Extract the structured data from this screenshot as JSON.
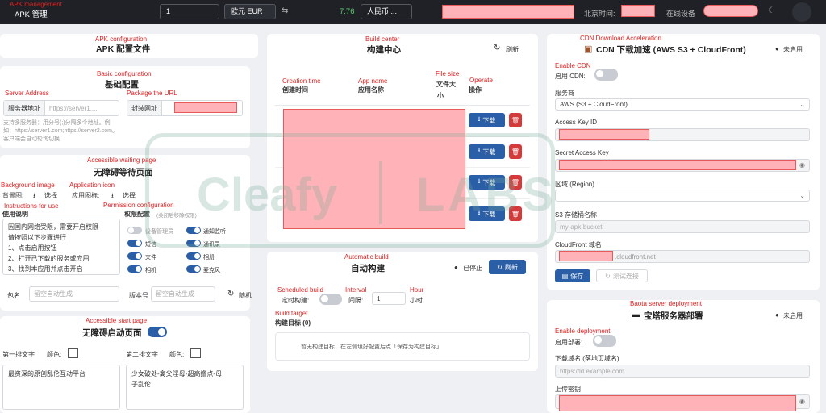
{
  "annotations": {
    "apk_management": "APK management",
    "apk_configuration": "APK configuration",
    "basic_configuration": "Basic configuration",
    "server_address": "Server Address",
    "package_url": "Package the URL",
    "accessible_waiting_page": "Accessible waiting page",
    "background_image": "Background image",
    "application_icon": "Application icon",
    "instructions_for_use": "Instructions for use",
    "permission_configuration": "Permission configuration",
    "accessible_start_page": "Accessible start page",
    "build_center": "Build center",
    "creation_time": "Creation time",
    "app_name": "App name",
    "file_size": "File size",
    "operate": "Operate",
    "automatic_build": "Automatic build",
    "scheduled_build": "Scheduled build",
    "interval": "Interval",
    "hour": "Hour",
    "build_target": "Build target",
    "cdn_download_acceleration": "CDN Download Acceleration",
    "enable_cdn": "Enable CDN",
    "baota_deployment": "Baota server deployment",
    "enable_deployment": "Enable deployment"
  },
  "topbar": {
    "title": "APK 管理",
    "amount": "1",
    "from_currency": "欧元 EUR",
    "swap_icon": "⇆",
    "rate": "7.76",
    "to_currency": "人民币 ...",
    "beijing_time_label": "北京时间:",
    "online_label": "在线设备",
    "theme_icon": "☾"
  },
  "apk_config": {
    "title": "APK 配置文件",
    "basic_title": "基础配置",
    "server_label": "服务器地址",
    "server_placeholder": "https://server1....",
    "package_url_label": "封装网址",
    "server_help_1": "支持多服务器：用分号(;)分隔多个地址。例",
    "server_help_2": "如：https://server1.com;https://server2.com。",
    "server_help_3": "客户端会自动轮询切换",
    "waiting_title": "无障碍等待页面",
    "bg_label": "背景图:",
    "choose_1": "选择",
    "icon_label": "应用图标:",
    "choose_2": "选择",
    "instructions_label": "使用说明",
    "permission_label": "权限配置",
    "permission_hint": "(关闭后移除权限)",
    "instructions_lines": [
      "因国内网络受限，需要开启权限",
      "请按照以下步骤进行",
      "1、点击启用按钮",
      "2、打开已下载的服务或应用",
      "3、找到本应用并点击开启"
    ],
    "permissions": [
      {
        "label": "设备管理员",
        "on": false
      },
      {
        "label": "通知监听",
        "on": true
      },
      {
        "label": "短信",
        "on": true
      },
      {
        "label": "通讯录",
        "on": true
      },
      {
        "label": "文件",
        "on": true
      },
      {
        "label": "相册",
        "on": true
      },
      {
        "label": "相机",
        "on": true
      },
      {
        "label": "麦克风",
        "on": true
      }
    ],
    "package_name_label": "包名",
    "auto_generate_1": "留空自动生成",
    "version_label": "版本号",
    "auto_generate_2": "留空自动生成",
    "random_label": "随机",
    "start_title": "无障碍启动页面",
    "line1_label": "第一排文字",
    "color_label_1": "颜色:",
    "line2_label": "第二排文字",
    "color_label_2": "颜色:",
    "line1_text": "最资深的原创乱伦互动平台",
    "line2_text_1": "少女破处-禽父淫母-超高撸点-母",
    "line2_text_2": "子乱伦"
  },
  "build_center": {
    "title": "构建中心",
    "refresh_label": "刷新",
    "col_time": "创建时间",
    "col_name": "应用名称",
    "col_size_1": "文件大",
    "col_size_2": "小",
    "col_ops": "操作",
    "download_label": "下载",
    "rows": 4
  },
  "auto_build": {
    "title": "自动构建",
    "status": "已停止",
    "refresh_label": "刷新",
    "timer_label": "定时构建:",
    "interval_label": "间隔:",
    "interval_value": "1",
    "hour_unit": "小时",
    "target_label": "构建目标 (0)",
    "empty_msg": "暂无构建目标，在左侧填好配置后点「保存为构建目标」"
  },
  "cdn": {
    "title": "CDN 下载加速 (AWS S3 + CloudFront)",
    "status": "未启用",
    "enable_label": "启用 CDN:",
    "provider_label": "服务商",
    "provider_value": "AWS (S3 + CloudFront)",
    "access_key_label": "Access Key ID",
    "secret_key_label": "Secret Access Key",
    "region_label": "区域 (Region)",
    "bucket_label": "S3 存储桶名称",
    "bucket_placeholder": "my-apk-bucket",
    "cloudfront_label": "CloudFront 域名",
    "cloudfront_suffix": ".cloudfront.net",
    "save_label": "保存",
    "test_label": "测试连接"
  },
  "baota": {
    "title": "宝塔服务器部署",
    "status": "未启用",
    "enable_label": "启用部署:",
    "domain_label": "下载域名 (落地页域名)",
    "domain_placeholder": "https://ld.example.com",
    "key_label": "上传密钥"
  },
  "watermark": {
    "left": "Cleafy",
    "right": "LABS"
  }
}
